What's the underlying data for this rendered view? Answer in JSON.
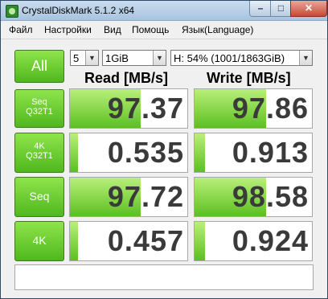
{
  "window": {
    "title": "CrystalDiskMark 5.1.2 x64"
  },
  "menu": [
    "Файл",
    "Настройки",
    "Вид",
    "Помощь",
    "Язык(Language)"
  ],
  "controls": {
    "all_label": "All",
    "count": "5",
    "size": "1GiB",
    "drive": "H: 54% (1001/1863GiB)"
  },
  "headers": {
    "read": "Read [MB/s]",
    "write": "Write [MB/s]"
  },
  "rows": [
    {
      "line1": "Seq",
      "line2": "Q32T1",
      "read": "97.37",
      "write": "97.86",
      "read_fill": 0.6,
      "write_fill": 0.61
    },
    {
      "line1": "4K",
      "line2": "Q32T1",
      "read": "0.535",
      "write": "0.913",
      "read_fill": 0.07,
      "write_fill": 0.09
    },
    {
      "line1": "Seq",
      "line2": "",
      "read": "97.72",
      "write": "98.58",
      "read_fill": 0.6,
      "write_fill": 0.61
    },
    {
      "line1": "4K",
      "line2": "",
      "read": "0.457",
      "write": "0.924",
      "read_fill": 0.07,
      "write_fill": 0.09
    }
  ],
  "status_text": ""
}
